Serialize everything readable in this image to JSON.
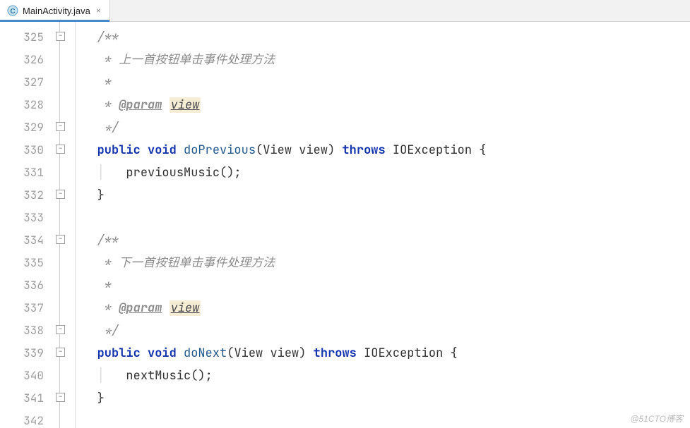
{
  "tab": {
    "filename": "MainActivity.java",
    "close": "×"
  },
  "gutter": {
    "start": 325,
    "end": 342,
    "fold_open": "−",
    "fold_close": "+"
  },
  "code": {
    "doc1_open": "/**",
    "doc1_desc": "上一首按钮单击事件处理方法",
    "doc_star": "*",
    "doc_paramtag": "@param",
    "doc_paramname": "view",
    "doc_close": "*/",
    "kw_public": "public",
    "kw_void": "void",
    "fn_prev": "doPrevious",
    "param_type": "View",
    "param_name": "view",
    "kw_throws": "throws",
    "ex_type": "IOException",
    "brace_open": "{",
    "call_prev": "previousMusic();",
    "brace_close": "}",
    "doc2_desc": "下一首按钮单击事件处理方法",
    "fn_next": "doNext",
    "call_next": "nextMusic();"
  },
  "watermark": "@51CTO博客"
}
